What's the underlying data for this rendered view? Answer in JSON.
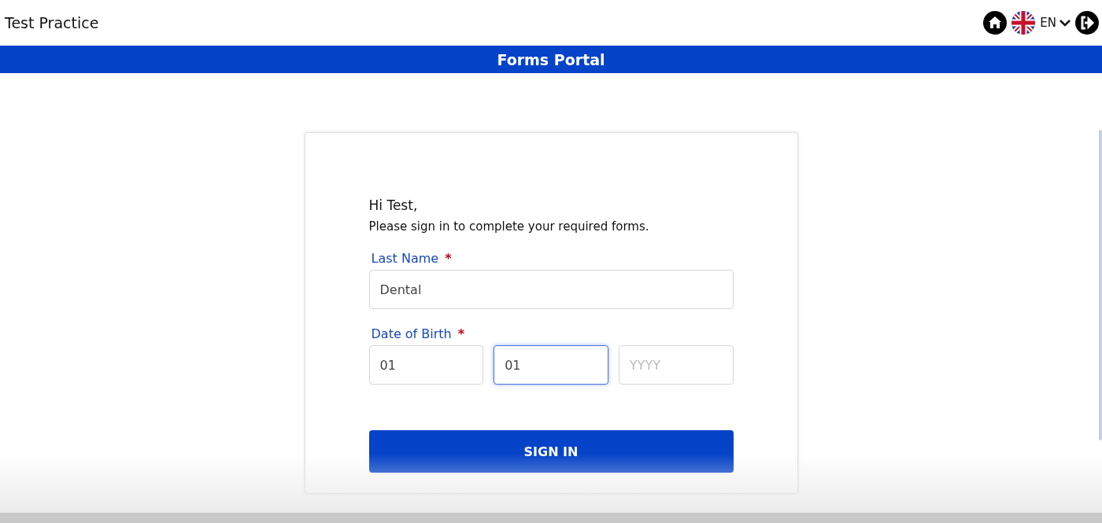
{
  "header": {
    "title": "Test Practice",
    "language": "EN"
  },
  "banner": {
    "title": "Forms Portal"
  },
  "form": {
    "greeting": "Hi Test,",
    "intro": "Please sign in to complete your required forms.",
    "last_name": {
      "label": "Last Name",
      "required_mark": "*",
      "value": "Dental",
      "focused": false
    },
    "date_of_birth": {
      "label": "Date of Birth",
      "required_mark": "*",
      "fields": [
        {
          "value": "01",
          "focused": false
        },
        {
          "value": "01",
          "focused": true
        },
        {
          "placeholder": "YYYY",
          "focused": false
        }
      ]
    },
    "submit": "SIGN IN"
  }
}
